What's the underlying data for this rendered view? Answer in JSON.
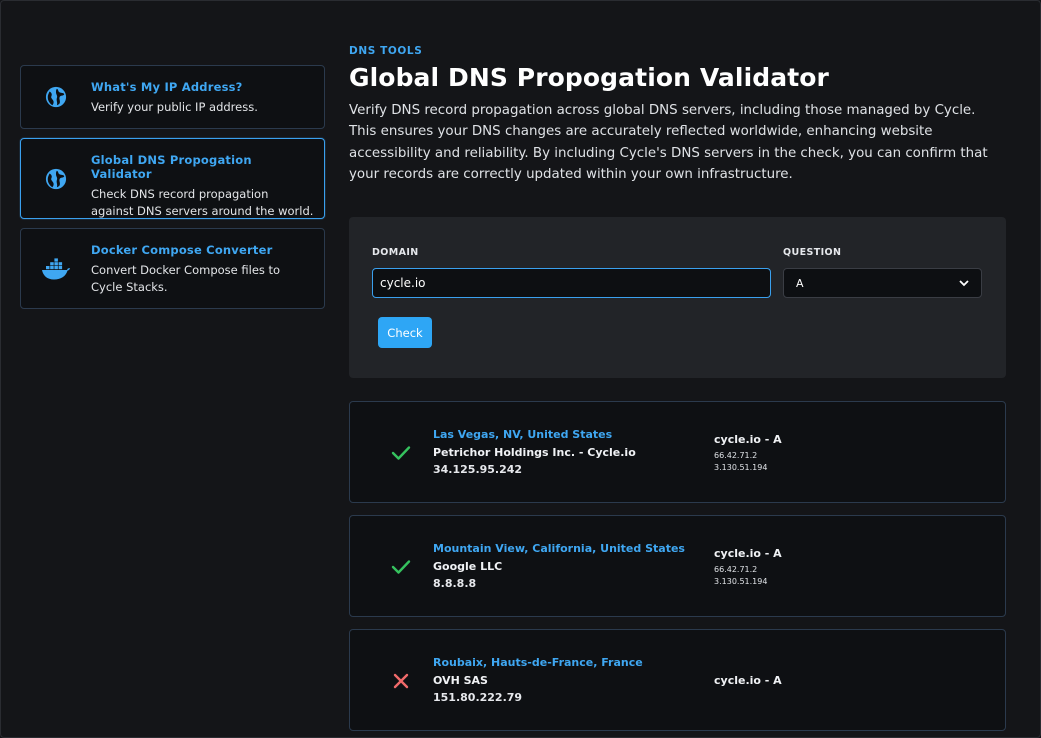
{
  "sidebar": {
    "items": [
      {
        "title": "What's My IP Address?",
        "description": "Verify your public IP address.",
        "icon": "globe-icon"
      },
      {
        "title": "Global DNS Propogation Validator",
        "description": "Check DNS record propagation against DNS servers around the world.",
        "icon": "globe-icon",
        "active": true
      },
      {
        "title": "Docker Compose Converter",
        "description": "Convert Docker Compose files to Cycle Stacks.",
        "icon": "docker-icon"
      }
    ]
  },
  "main": {
    "eyebrow": "DNS TOOLS",
    "title": "Global DNS Propogation Validator",
    "intro": "Verify DNS record propagation across global DNS servers, including those managed by Cycle. This ensures your DNS changes are accurately reflected worldwide, enhancing website accessibility and reliability. By including Cycle's DNS servers in the check, you can confirm that your records are correctly updated within your own infrastructure."
  },
  "form": {
    "domain_label": "DOMAIN",
    "domain_value": "cycle.io",
    "question_label": "QUESTION",
    "question_value": "A",
    "check_label": "Check"
  },
  "results": [
    {
      "status": "success",
      "location": "Las Vegas, NV, United States",
      "org": "Petrichor Holdings Inc. - Cycle.io",
      "ip": "34.125.95.242",
      "query": "cycle.io - A",
      "answers": [
        "66.42.71.2",
        "3.130.51.194"
      ]
    },
    {
      "status": "success",
      "location": "Mountain View, California, United States",
      "org": "Google LLC",
      "ip": "8.8.8.8",
      "query": "cycle.io - A",
      "answers": [
        "66.42.71.2",
        "3.130.51.194"
      ]
    },
    {
      "status": "fail",
      "location": "Roubaix, Hauts-de-France, France",
      "org": "OVH SAS",
      "ip": "151.80.222.79",
      "query": "cycle.io - A",
      "answers": []
    }
  ],
  "colors": {
    "accent": "#3fa7f2",
    "success": "#35c25e",
    "fail": "#f06a6a",
    "background": "#141518"
  }
}
